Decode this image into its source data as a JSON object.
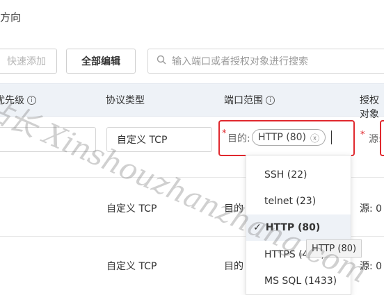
{
  "header": {
    "title": "方向"
  },
  "toolbar": {
    "quick_add_label": "快速添加",
    "edit_all_label": "全部编辑",
    "search_placeholder": "输入端口或者授权对象进行搜索"
  },
  "table": {
    "headers": [
      "优先级",
      "协议类型",
      "端口范围",
      "授权对象"
    ],
    "edit_row": {
      "protocol": "自定义 TCP",
      "port_prefix": "目的:",
      "port_tag": "HTTP (80)",
      "auth_prefix": "源:"
    },
    "rows": [
      {
        "protocol": "自定义 TCP",
        "port_prefix": "目的",
        "auth": "源: 0"
      },
      {
        "protocol": "自定义 TCP",
        "port_prefix": "目的",
        "auth": "源: 0"
      }
    ]
  },
  "dropdown": {
    "options": [
      "SSH (22)",
      "telnet (23)",
      "HTTP (80)",
      "HTTPS (443)",
      "MS SQL (1433)"
    ],
    "selected": "HTTP (80)",
    "check": "✓"
  },
  "tooltip": {
    "text": "HTTP (80)"
  },
  "watermark": {
    "text": "站长 Xinshouzhanzhang.com"
  },
  "colors": {
    "highlight_border": "#e0282e",
    "header_bg": "#eef2f7",
    "selected_bg": "#eef2f7"
  }
}
